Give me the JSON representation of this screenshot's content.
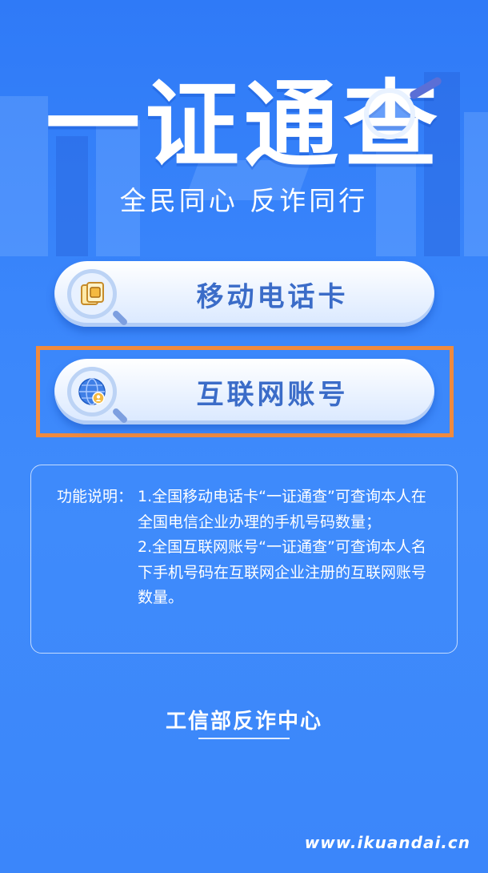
{
  "header": {
    "title": "一证通查",
    "slogan": "全民同心  反诈同行"
  },
  "buttons": {
    "mobile_card": {
      "label": "移动电话卡",
      "icon": "sim-card-icon"
    },
    "internet_account": {
      "label": "互联网账号",
      "icon": "globe-user-icon"
    }
  },
  "description": {
    "label": "功能说明：",
    "item1": "1.全国移动电话卡“一证通查”可查询本人在全国电信企业办理的手机号码数量；",
    "item2": "2.全国互联网账号“一证通查”可查询本人名下手机号码在互联网企业注册的互联网账号数量。"
  },
  "footer": {
    "org": "工信部反诈中心"
  },
  "watermark": "www.ikuandai.cn",
  "colors": {
    "background": "#3a86fb",
    "button_text": "#3b6cc8",
    "highlight": "#f08a3e"
  }
}
